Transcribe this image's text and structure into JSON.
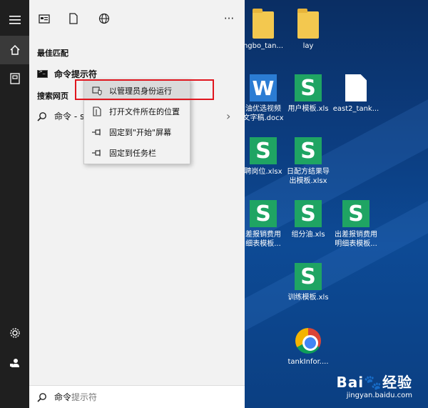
{
  "rail": {
    "items": [
      {
        "icon": "hamburger-menu-icon"
      },
      {
        "icon": "home-icon"
      },
      {
        "icon": "documents-icon"
      },
      {
        "icon": "settings-icon"
      },
      {
        "icon": "feedback-icon"
      }
    ]
  },
  "panel": {
    "top_icons": [
      "app-icon",
      "document-icon",
      "globe-icon",
      "more-icon"
    ],
    "more_label": "···",
    "best_match_heading": "最佳匹配",
    "best_match_item": "命令提示符",
    "web_heading": "搜索网页",
    "web_item_prefix": "命令 - ",
    "web_item_suffix": "s",
    "search_typed": "命令",
    "search_hint": "提示符"
  },
  "context_menu": {
    "items": [
      {
        "label": "以管理员身份运行",
        "icon": "shield-icon"
      },
      {
        "label": "打开文件所在的位置",
        "icon": "folder-location-icon"
      },
      {
        "label": "固定到\"开始\"屏幕",
        "icon": "pin-icon"
      },
      {
        "label": "固定到任务栏",
        "icon": "pin-icon"
      }
    ],
    "highlight_color": "#e0161e"
  },
  "desktop": {
    "icons": [
      {
        "label": "ngbo_tan...",
        "type": "folder"
      },
      {
        "label": "lay",
        "type": "folder-ie"
      },
      {
        "label": "油优选视频\n文字稿.docx",
        "type": "wps-writer"
      },
      {
        "label": "用户模板.xls",
        "type": "wps-sheet"
      },
      {
        "label": "east2_tank...",
        "type": "document"
      },
      {
        "label": "聘岗位.xlsx",
        "type": "wps-sheet"
      },
      {
        "label": "日配方结果导\n出模板.xlsx",
        "type": "wps-sheet"
      },
      {
        "label": "差报销费用\n细表模板...",
        "type": "wps-sheet"
      },
      {
        "label": "组分油.xls",
        "type": "wps-sheet"
      },
      {
        "label": "出差报销费用\n明细表模板...",
        "type": "wps-sheet"
      },
      {
        "label": "训练模板.xls",
        "type": "wps-sheet"
      },
      {
        "label": "tankInfor....",
        "type": "chrome"
      }
    ]
  },
  "watermark": {
    "brand": "Bai🐾经验",
    "url": "jingyan.baidu.com"
  }
}
